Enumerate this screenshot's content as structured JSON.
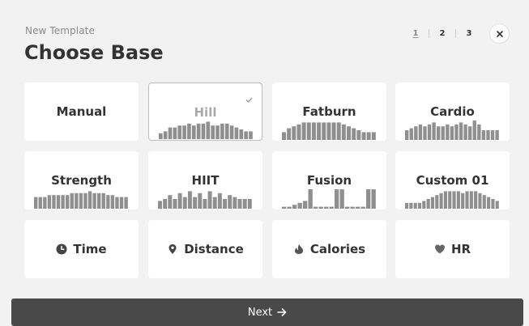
{
  "header": {
    "subtitle": "New Template",
    "title": "Choose Base"
  },
  "steps": {
    "items": [
      "1",
      "2",
      "3"
    ],
    "current": "1"
  },
  "cards": {
    "manual": {
      "label": "Manual"
    },
    "hill": {
      "label": "Hill",
      "selected": true,
      "bars": [
        3,
        4,
        6,
        6,
        7,
        7,
        8,
        7,
        8,
        8,
        9,
        7,
        7,
        8,
        8,
        7,
        6,
        5,
        4,
        4
      ]
    },
    "fatburn": {
      "label": "Fatburn",
      "bars": [
        4,
        6,
        7,
        8,
        9,
        9,
        9,
        9,
        9,
        9,
        9,
        9,
        8,
        7,
        6,
        5,
        4,
        4,
        4
      ]
    },
    "cardio": {
      "label": "Cardio",
      "bars": [
        5,
        6,
        7,
        8,
        7,
        8,
        9,
        7,
        7,
        8,
        7,
        8,
        9,
        8,
        7,
        10,
        8,
        5,
        5,
        5,
        5
      ]
    },
    "strength": {
      "label": "Strength",
      "bars": [
        6,
        6,
        6,
        7,
        7,
        7,
        7,
        7,
        8,
        8,
        8,
        8,
        9,
        8,
        8,
        8,
        7,
        7,
        6,
        6,
        6
      ]
    },
    "hiit": {
      "label": "HIIT",
      "bars": [
        4,
        5,
        7,
        5,
        8,
        6,
        9,
        6,
        8,
        5,
        9,
        6,
        8,
        5,
        7,
        6,
        5,
        5,
        5
      ]
    },
    "fusion": {
      "label": "Fusion",
      "bars": [
        1,
        1,
        2,
        3,
        4,
        10,
        1,
        1,
        1,
        1,
        10,
        10,
        1,
        1,
        1,
        1,
        10,
        10
      ]
    },
    "custom01": {
      "label": "Custom 01",
      "bars": [
        3,
        3,
        3,
        3,
        4,
        5,
        6,
        7,
        8,
        9,
        9,
        9,
        9,
        8,
        9,
        9,
        9,
        8,
        7,
        6,
        5,
        4
      ]
    },
    "time": {
      "label": "Time",
      "icon": "clock-icon"
    },
    "distance": {
      "label": "Distance",
      "icon": "map-pin-icon"
    },
    "calories": {
      "label": "Calories",
      "icon": "flame-icon"
    },
    "hr": {
      "label": "HR",
      "icon": "heart-icon"
    }
  },
  "next_button": {
    "label": "Next",
    "icon": "arrow-right-icon"
  },
  "colors": {
    "background": "#f2f2f2",
    "card": "#ffffff",
    "bar": "#8f8f8f",
    "button": "#494949",
    "text": "#333333"
  }
}
